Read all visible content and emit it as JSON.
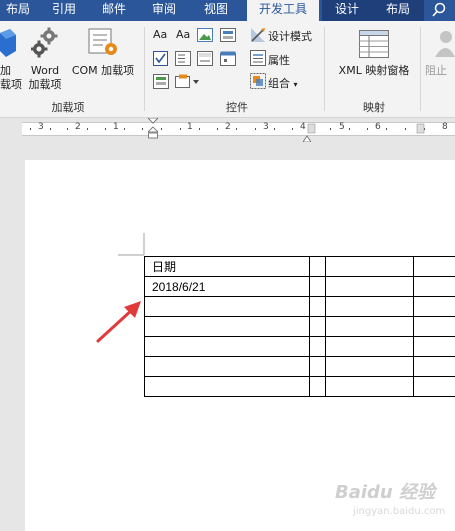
{
  "tabs": [
    {
      "label": "布局",
      "active": false
    },
    {
      "label": "引用",
      "active": false
    },
    {
      "label": "邮件",
      "active": false
    },
    {
      "label": "审阅",
      "active": false
    },
    {
      "label": "视图",
      "active": false
    },
    {
      "label": "开发工具",
      "active": true
    },
    {
      "label": "设计",
      "active": false
    },
    {
      "label": "布局",
      "active": false
    }
  ],
  "ribbon": {
    "addins": {
      "partial_button_line1": "加",
      "partial_button_line2": "载项",
      "word_line1": "Word",
      "word_line2": "加载项",
      "com_line1": "COM",
      "com_line2": "加载项",
      "group_label": "加载项"
    },
    "controls": {
      "design_mode": "设计模式",
      "properties": "属性",
      "group": "组合",
      "group_label": "控件"
    },
    "mapping": {
      "xml_mapping_pane": "XML 映射窗格",
      "group_label": "映射"
    },
    "protect": {
      "block_authors_partial": "阻止"
    }
  },
  "ruler": {
    "numbers": [
      "3",
      "2",
      "1",
      "1",
      "2",
      "3",
      "4",
      "5",
      "6",
      "8"
    ]
  },
  "document": {
    "table": {
      "rows": [
        [
          "日期",
          "",
          "",
          ""
        ],
        [
          "2018/6/21",
          "",
          "",
          ""
        ],
        [
          "",
          "",
          "",
          ""
        ],
        [
          "",
          "",
          "",
          ""
        ],
        [
          "",
          "",
          "",
          ""
        ],
        [
          "",
          "",
          "",
          ""
        ],
        [
          "",
          "",
          "",
          ""
        ]
      ]
    }
  },
  "watermark": {
    "text": "Baidu 经验",
    "sub": "jingyan.baidu.com"
  },
  "colors": {
    "tab_bar": "#2b579a",
    "ribbon_bg": "#f3f3f3",
    "arrow": "#e03a3a"
  }
}
